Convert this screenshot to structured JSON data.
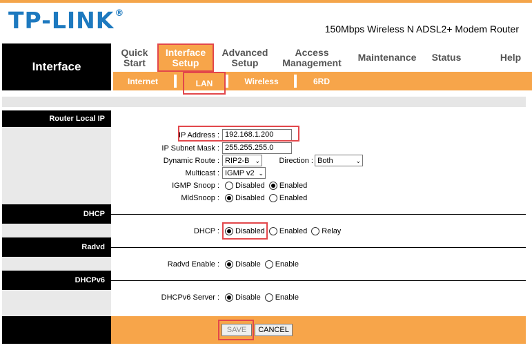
{
  "header": {
    "logo": "TP-LINK",
    "logo_mark": "®",
    "model": "150Mbps Wireless N ADSL2+ Modem Router"
  },
  "nav": {
    "section_title": "Interface",
    "items": [
      {
        "label": "Quick Start"
      },
      {
        "label": "Interface Setup",
        "active": true
      },
      {
        "label": "Advanced Setup"
      },
      {
        "label": "Access Management"
      },
      {
        "label": "Maintenance"
      },
      {
        "label": "Status"
      },
      {
        "label": "Help"
      }
    ],
    "subitems": [
      {
        "label": "Internet"
      },
      {
        "label": "LAN",
        "active": true
      },
      {
        "label": "Wireless"
      },
      {
        "label": "6RD"
      }
    ]
  },
  "sections": {
    "router_local_ip": "Router Local IP",
    "dhcp": "DHCP",
    "radvd": "Radvd",
    "dhcpv6": "DHCPv6"
  },
  "form": {
    "ip_address": {
      "label": "IP Address :",
      "value": "192.168.1.200"
    },
    "subnet_mask": {
      "label": "IP Subnet Mask :",
      "value": "255.255.255.0"
    },
    "dynamic_route": {
      "label": "Dynamic Route :",
      "value": "RIP2-B"
    },
    "direction": {
      "label": "Direction :",
      "value": "Both"
    },
    "multicast": {
      "label": "Multicast :",
      "value": "IGMP v2"
    },
    "igmp_snoop": {
      "label": "IGMP Snoop :",
      "options": [
        "Disabled",
        "Enabled"
      ],
      "selected": "Enabled"
    },
    "mld_snoop": {
      "label": "MldSnoop :",
      "options": [
        "Disabled",
        "Enabled"
      ],
      "selected": "Disabled"
    },
    "dhcp": {
      "label": "DHCP :",
      "options": [
        "Disabled",
        "Enabled",
        "Relay"
      ],
      "selected": "Disabled"
    },
    "radvd_enable": {
      "label": "Radvd Enable :",
      "options": [
        "Disable",
        "Enable"
      ],
      "selected": "Disable"
    },
    "dhcpv6_server": {
      "label": "DHCPv6 Server :",
      "options": [
        "Disable",
        "Enable"
      ],
      "selected": "Disable"
    }
  },
  "buttons": {
    "save": "SAVE",
    "cancel": "CANCEL"
  },
  "colors": {
    "accent": "#f7a54a",
    "logo": "#1d79bf",
    "highlight": "#e2474b"
  }
}
